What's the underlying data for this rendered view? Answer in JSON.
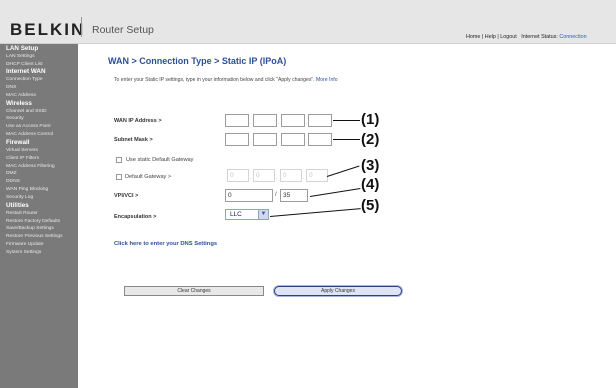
{
  "header": {
    "logo": "BELKIN",
    "title": "Router Setup",
    "links": {
      "home": "Home",
      "help": "Help",
      "logout": "Logout",
      "sep": " | ",
      "status_label": "Internet Status:",
      "status_value": "Connection"
    }
  },
  "sidebar": {
    "sections": [
      {
        "heading": "LAN Setup",
        "items": [
          "LAN Settings",
          "DHCP Client List"
        ]
      },
      {
        "heading": "Internet WAN",
        "items": [
          "Connection Type",
          "DNS",
          "MAC Address"
        ]
      },
      {
        "heading": "Wireless",
        "items": [
          "Channel and SSID",
          "Security",
          "Use as Access Point",
          "MAC Address Control"
        ]
      },
      {
        "heading": "Firewall",
        "items": [
          "Virtual Servers",
          "Client IP Filters",
          "MAC Address Filtering",
          "DMZ",
          "DDNS",
          "WAN Ping Blocking",
          "Security Log"
        ]
      },
      {
        "heading": "Utilities",
        "items": [
          "Restart Router",
          "Restore Factory Defaults",
          "Save/Backup Settings",
          "Restore Previous Settings",
          "Firmware Update",
          "System Settings"
        ]
      }
    ]
  },
  "main": {
    "title": "WAN > Connection Type > Static IP (IPoA)",
    "intro": "To enter your Static IP settings, type in your information below and click \"Apply changes\".",
    "more_info": "More Info",
    "fields": {
      "wan_ip_label": "WAN IP Address >",
      "subnet_label": "Subnet Mask >",
      "static_gw_label": "Use static Default Gateway",
      "default_gw_label": "Default Gateway >",
      "default_gw_values": [
        "0",
        "0",
        "0",
        "0"
      ],
      "vpivci_label": "VPI/VCI >",
      "vpi_value": "0",
      "vpivci_sep": "/",
      "vci_value": "35",
      "encap_label": "Encapsulation >",
      "encap_value": "LLC"
    },
    "dns_link": "Click here to enter your DNS Settings",
    "buttons": {
      "clear": "Clear Changes",
      "apply": "Apply Changes"
    }
  },
  "callouts": [
    "(1)",
    "(2)",
    "(3)",
    "(4)",
    "(5)"
  ]
}
